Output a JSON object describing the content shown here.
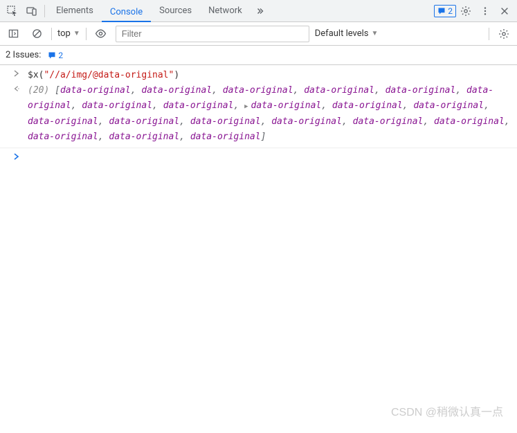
{
  "tabs": {
    "elements": "Elements",
    "console": "Console",
    "sources": "Sources",
    "network": "Network"
  },
  "msg_count": "2",
  "toolbar": {
    "ctx": "top",
    "filter_placeholder": "Filter",
    "levels": "Default levels"
  },
  "issues": {
    "label": "2 Issues:",
    "count": "2"
  },
  "cmd": {
    "prefix": "$x(",
    "arg": "\"//a/img/@data-original\"",
    "suffix": ")"
  },
  "result": {
    "count": "(20) ",
    "open": "[",
    "close": "]",
    "item": "data-original",
    "sep": ", ",
    "num_items": 20,
    "expand_index": 8
  },
  "watermark": "CSDN @稍微认真一点"
}
